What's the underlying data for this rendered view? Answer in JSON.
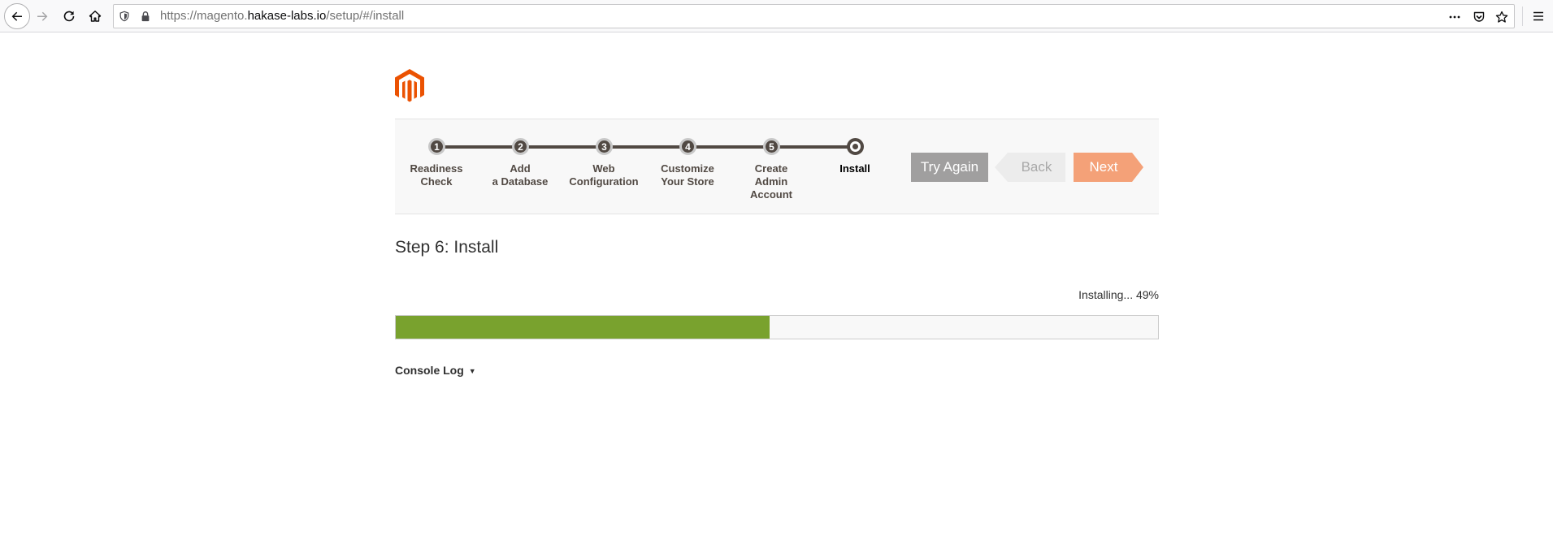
{
  "browser": {
    "url_prefix": "https://magento.",
    "url_host": "hakase-labs.io",
    "url_suffix": "/setup/#/install"
  },
  "wizard": {
    "steps": [
      {
        "number": "1",
        "label": "Readiness\nCheck",
        "state": "done"
      },
      {
        "number": "2",
        "label": "Add\na Database",
        "state": "done"
      },
      {
        "number": "3",
        "label": "Web\nConfiguration",
        "state": "done"
      },
      {
        "number": "4",
        "label": "Customize\nYour Store",
        "state": "done"
      },
      {
        "number": "5",
        "label": "Create\nAdmin\nAccount",
        "state": "done"
      },
      {
        "number": "",
        "label": "Install",
        "state": "active"
      }
    ],
    "buttons": {
      "try_again": "Try Again",
      "back": "Back",
      "next": "Next"
    }
  },
  "main": {
    "step_title": "Step 6: Install",
    "progress_text": "Installing... 49%",
    "progress_percent": 49,
    "console_log_label": "Console Log",
    "console_log_caret": "▼"
  },
  "colors": {
    "brand_orange": "#eb5202",
    "progress_green": "#79a22e",
    "next_button": "#f4a178",
    "step_dark": "#514943"
  }
}
